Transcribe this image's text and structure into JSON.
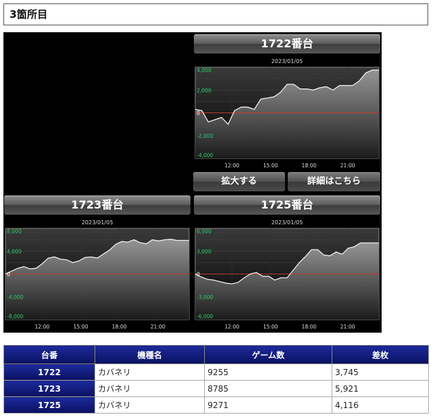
{
  "section_title": "3箇所目",
  "buttons": {
    "zoom": "拡大する",
    "details": "詳細はこちら"
  },
  "charts": [
    {
      "title": "1722番台",
      "date": "2023/01/05",
      "y_ticks": [
        "4,000",
        "2,000",
        "0",
        "-2,000",
        "-4,000"
      ],
      "x_ticks": [
        "12:00",
        "15:00",
        "18:00",
        "21:00"
      ]
    },
    {
      "title": "1723番台",
      "date": "2023/01/05",
      "y_ticks": [
        "8,000",
        "4,000",
        "0",
        "-4,000",
        "-8,000"
      ],
      "x_ticks": [
        "12:00",
        "15:00",
        "18:00",
        "21:00"
      ]
    },
    {
      "title": "1725番台",
      "date": "2023/01/05",
      "y_ticks": [
        "6,000",
        "3,000",
        "0",
        "-3,000",
        "-6,000"
      ],
      "x_ticks": [
        "12:00",
        "15:00",
        "18:00",
        "21:00"
      ]
    }
  ],
  "chart_data": [
    {
      "type": "area",
      "title": "1722番台",
      "subtitle": "2023/01/05",
      "ylim": [
        -4000,
        4000
      ],
      "x_ticks": [
        "12:00",
        "15:00",
        "18:00",
        "21:00"
      ],
      "y": [
        300,
        200,
        -800,
        -600,
        -400,
        -1000,
        200,
        500,
        500,
        300,
        1200,
        1300,
        1400,
        1800,
        2500,
        2500,
        2100,
        2100,
        2000,
        2200,
        2300,
        2000,
        2400,
        2400,
        2400,
        2800,
        3500,
        3750,
        3750
      ]
    },
    {
      "type": "area",
      "title": "1723番台",
      "subtitle": "2023/01/05",
      "ylim": [
        -8000,
        8000
      ],
      "x_ticks": [
        "12:00",
        "15:00",
        "18:00",
        "21:00"
      ],
      "y": [
        0,
        500,
        1000,
        1300,
        900,
        1000,
        1800,
        2800,
        3000,
        2600,
        2500,
        2000,
        2300,
        2900,
        3000,
        2800,
        3500,
        4200,
        5200,
        5700,
        5600,
        6000,
        5500,
        5300,
        6000,
        5800,
        6000,
        6100,
        5900,
        5900,
        5900
      ]
    },
    {
      "type": "area",
      "title": "1725番台",
      "subtitle": "2023/01/05",
      "ylim": [
        -6000,
        6000
      ],
      "x_ticks": [
        "12:00",
        "15:00",
        "18:00",
        "21:00"
      ],
      "y": [
        0,
        -400,
        -700,
        -800,
        -1000,
        -1200,
        -1300,
        -1100,
        -500,
        0,
        200,
        -300,
        -300,
        -800,
        -500,
        -500,
        500,
        1500,
        2300,
        3200,
        3200,
        2500,
        2400,
        2900,
        2600,
        3400,
        3600,
        4100,
        4100,
        4100,
        4100
      ]
    }
  ],
  "table": {
    "headers": [
      "台番",
      "機種名",
      "ゲーム数",
      "差枚"
    ],
    "rows": [
      [
        "1722",
        "カバネリ",
        "9255",
        "3,745"
      ],
      [
        "1723",
        "カバネリ",
        "8785",
        "5,921"
      ],
      [
        "1725",
        "カバネリ",
        "9271",
        "4,116"
      ]
    ]
  }
}
